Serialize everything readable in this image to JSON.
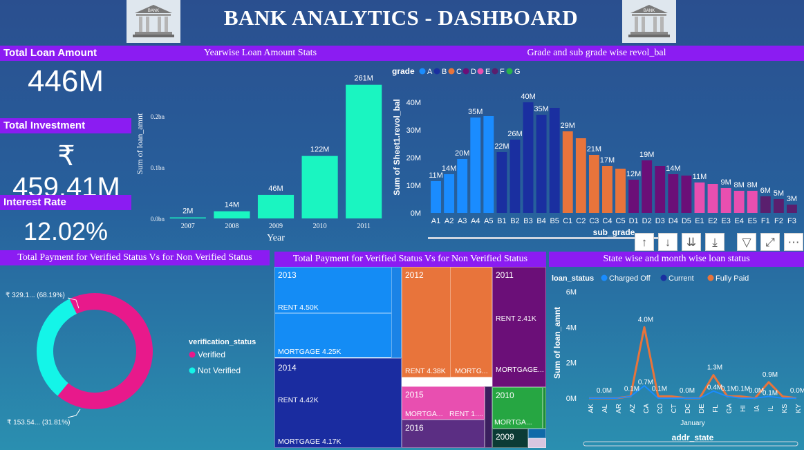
{
  "header": {
    "title": "BANK ANALYTICS - DASHBOARD",
    "logo_text": "BANK"
  },
  "kpis": {
    "total_loan_label": "Total Loan Amount",
    "total_loan_value": "446M",
    "total_investment_label": "Total Investment",
    "total_investment_value": "₹ 459.41M",
    "interest_rate_label": "Interest Rate",
    "interest_rate_value": "12.02%"
  },
  "colors": {
    "teal_bar": "#1af5c1",
    "purple_header": "#8b1cf2",
    "grade_A": "#1a8cff",
    "grade_B": "#1a2fa0",
    "grade_C": "#e8743b",
    "grade_D": "#6b0f78",
    "grade_E": "#e84fb0",
    "grade_F": "#5a1f6e",
    "grade_G": "#28b14c",
    "verified": "#e8198b",
    "not_verified": "#14f5e8"
  },
  "panels": {
    "yearwise_title": "Yearwise Loan Amount Stats",
    "grade_title": "Grade and sub grade wise revol_bal",
    "donut_title": "Total Payment for Verified Status Vs for Non Verified Status",
    "treemap_title": "Total Payment for Verified Status Vs for Non Verified Status",
    "state_title": "State wise and month wise loan status"
  },
  "chart_data": [
    {
      "type": "bar",
      "xlabel": "Year",
      "ylabel": "Sum of loan_amnt",
      "categories": [
        "2007",
        "2008",
        "2009",
        "2010",
        "2011"
      ],
      "values": [
        2,
        14,
        46,
        122,
        261
      ],
      "data_labels": [
        "2M",
        "14M",
        "46M",
        "122M",
        "261M"
      ],
      "yticks": [
        "0.0bn",
        "0.1bn",
        "0.2bn"
      ],
      "ytick_values": [
        0,
        100,
        200
      ],
      "ylim": [
        0,
        270
      ]
    },
    {
      "type": "bar",
      "xlabel": "sub_grade",
      "ylabel": "Sum of Sheet1.revol_bal",
      "legend_title": "grade",
      "legend": [
        "A",
        "B",
        "C",
        "D",
        "E",
        "F",
        "G"
      ],
      "categories": [
        "A1",
        "A2",
        "A3",
        "A4",
        "A5",
        "B1",
        "B2",
        "B3",
        "B4",
        "B5",
        "C1",
        "C2",
        "C3",
        "C4",
        "C5",
        "D1",
        "D2",
        "D3",
        "D4",
        "D5",
        "E1",
        "E2",
        "E3",
        "E4",
        "E5",
        "F1",
        "F2",
        "F3"
      ],
      "values": [
        11.5,
        14,
        19.5,
        34.5,
        35,
        22,
        26.5,
        40,
        35.5,
        38,
        29.5,
        27,
        21,
        17,
        16,
        12,
        19,
        17,
        14,
        13.5,
        11,
        10.5,
        9,
        8,
        8,
        6,
        5,
        3
      ],
      "data_labels": [
        "11M",
        "14M",
        "20M",
        "35M",
        "",
        "22M",
        "26M",
        "40M",
        "35M",
        "",
        "29M",
        "",
        "21M",
        "17M",
        "",
        "12M",
        "19M",
        "",
        "14M",
        "",
        "11M",
        "",
        "9M",
        "8M",
        "8M",
        "6M",
        "5M",
        "3M"
      ],
      "grades": [
        "A",
        "A",
        "A",
        "A",
        "A",
        "B",
        "B",
        "B",
        "B",
        "B",
        "C",
        "C",
        "C",
        "C",
        "C",
        "D",
        "D",
        "D",
        "D",
        "D",
        "E",
        "E",
        "E",
        "E",
        "E",
        "F",
        "F",
        "F"
      ],
      "yticks": [
        "0M",
        "10M",
        "20M",
        "30M",
        "40M"
      ],
      "ytick_values": [
        0,
        10,
        20,
        30,
        40
      ],
      "ylim": [
        0,
        43
      ]
    },
    {
      "type": "pie",
      "legend_title": "verification_status",
      "labels": [
        "Verified",
        "Not Verified"
      ],
      "values": [
        68.19,
        31.81
      ],
      "data_labels": [
        "₹ 329.1... (68.19%)",
        "₹ 153.54... (31.81%)"
      ]
    },
    {
      "type": "treemap",
      "cells": [
        {
          "year": "2013",
          "items": [
            {
              "label": "RENT 4.50K",
              "value": 4.5
            },
            {
              "label": "MORTGAGE 4.25K",
              "value": 4.25
            }
          ]
        },
        {
          "year": "2014",
          "items": [
            {
              "label": "RENT 4.42K",
              "value": 4.42
            },
            {
              "label": "MORTGAGE 4.17K",
              "value": 4.17
            }
          ]
        },
        {
          "year": "2012",
          "items": [
            {
              "label": "RENT 4.38K",
              "value": 4.38
            },
            {
              "label": "MORTG...",
              "value": 0
            }
          ]
        },
        {
          "year": "2015",
          "items": [
            {
              "label": "MORTGA...",
              "value": 0
            },
            {
              "label": "RENT 1....",
              "value": 0
            }
          ]
        },
        {
          "year": "2016",
          "items": []
        },
        {
          "year": "2011",
          "items": [
            {
              "label": "RENT 2.41K",
              "value": 2.41
            },
            {
              "label": "MORTGAGE...",
              "value": 0
            }
          ]
        },
        {
          "year": "2010",
          "items": [
            {
              "label": "MORTGA...",
              "value": 0
            }
          ]
        },
        {
          "year": "2009",
          "items": []
        }
      ]
    },
    {
      "type": "line",
      "xlabel": "addr_state",
      "x_sublabel": "January",
      "ylabel": "Sum of loan_amnt",
      "legend_title": "loan_status",
      "legend": [
        "Charged Off",
        "Current",
        "Fully Paid"
      ],
      "categories": [
        "AK",
        "AL",
        "AR",
        "AZ",
        "CA",
        "CO",
        "CT",
        "DC",
        "DE",
        "FL",
        "GA",
        "HI",
        "IA",
        "IL",
        "KS",
        "KY"
      ],
      "series": [
        {
          "name": "Fully Paid",
          "values": [
            0.0,
            0.0,
            0.0,
            0.1,
            4.0,
            0.1,
            0.1,
            0.0,
            0.0,
            1.3,
            0.1,
            0.1,
            0.0,
            0.9,
            0.1,
            0.0
          ]
        },
        {
          "name": "Charged Off",
          "values": [
            0.0,
            0.0,
            0.0,
            0.1,
            0.7,
            0.0,
            0.0,
            0.0,
            0.0,
            0.4,
            0.1,
            0.0,
            0.0,
            0.1,
            0.0,
            0.0
          ]
        }
      ],
      "data_labels": [
        {
          "index": 1,
          "text": "0.0M"
        },
        {
          "index": 3,
          "text": "0.1M"
        },
        {
          "index": 4,
          "text": "4.0M"
        },
        {
          "index": 4,
          "text": "0.7M"
        },
        {
          "index": 5,
          "text": "0.1M"
        },
        {
          "index": 7,
          "text": "0.0M"
        },
        {
          "index": 9,
          "text": "1.3M"
        },
        {
          "index": 9,
          "text": "0.4M"
        },
        {
          "index": 10,
          "text": "0.1M"
        },
        {
          "index": 11,
          "text": "0.1M"
        },
        {
          "index": 12,
          "text": "0.0M"
        },
        {
          "index": 13,
          "text": "0.9M"
        },
        {
          "index": 13,
          "text": "0.1M"
        },
        {
          "index": 15,
          "text": "0.0M"
        }
      ],
      "yticks": [
        "0M",
        "2M",
        "4M",
        "6M"
      ],
      "ytick_values": [
        0,
        2,
        4,
        6
      ],
      "ylim": [
        0,
        6
      ]
    }
  ]
}
